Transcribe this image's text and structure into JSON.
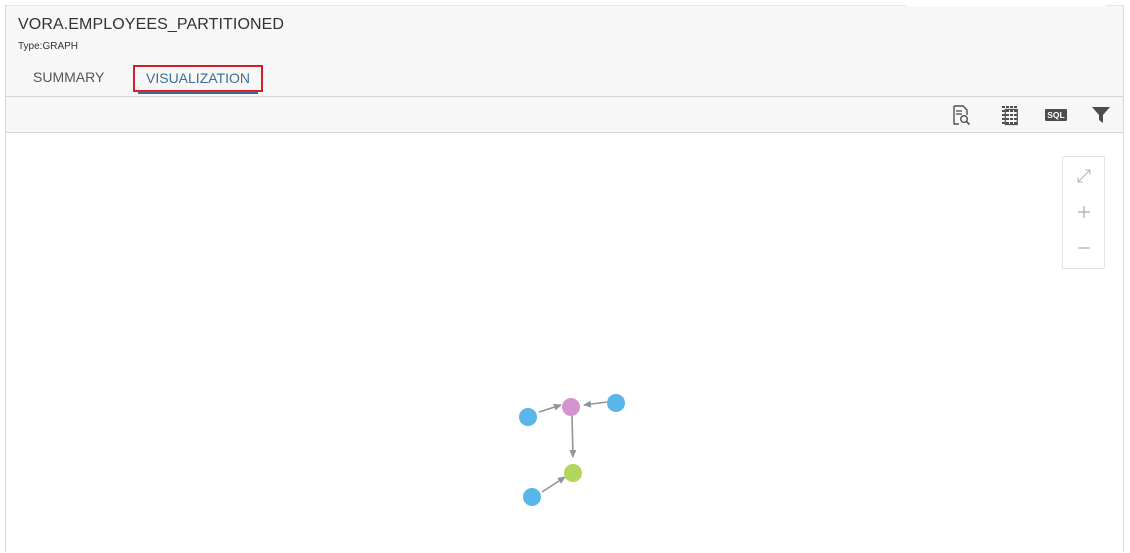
{
  "object": {
    "title": "VORA.EMPLOYEES_PARTITIONED",
    "type": "Type:GRAPH"
  },
  "tabs": [
    {
      "label": "SUMMARY",
      "active": false
    },
    {
      "label": "VISUALIZATION",
      "active": true
    }
  ],
  "toolbar": {
    "tools": [
      "data-preview-icon",
      "table-grid-icon",
      "sql-icon",
      "filter-icon"
    ],
    "sql_label": "SQL"
  },
  "zoom_controls": [
    "fit-to-screen-icon",
    "zoom-in-icon",
    "zoom-out-icon"
  ],
  "graph": {
    "nodes": [
      {
        "id": "center",
        "color": "#d394cf"
      },
      {
        "id": "left",
        "color": "#5ab5e8"
      },
      {
        "id": "right",
        "color": "#5ab5e8"
      },
      {
        "id": "bottom",
        "color": "#b2d65b"
      },
      {
        "id": "bottom-left",
        "color": "#5ab5e8"
      }
    ],
    "edges": [
      {
        "from": "left",
        "to": "center"
      },
      {
        "from": "right",
        "to": "center"
      },
      {
        "from": "center",
        "to": "bottom"
      },
      {
        "from": "bottom-left",
        "to": "bottom"
      }
    ],
    "edge_color": "#8f959c"
  },
  "colors": {
    "active_tab_text": "#3b6e96",
    "active_tab_underline": "#3f6a8f",
    "highlight_border": "#d21f26",
    "header_bg": "#f7f7f7"
  }
}
